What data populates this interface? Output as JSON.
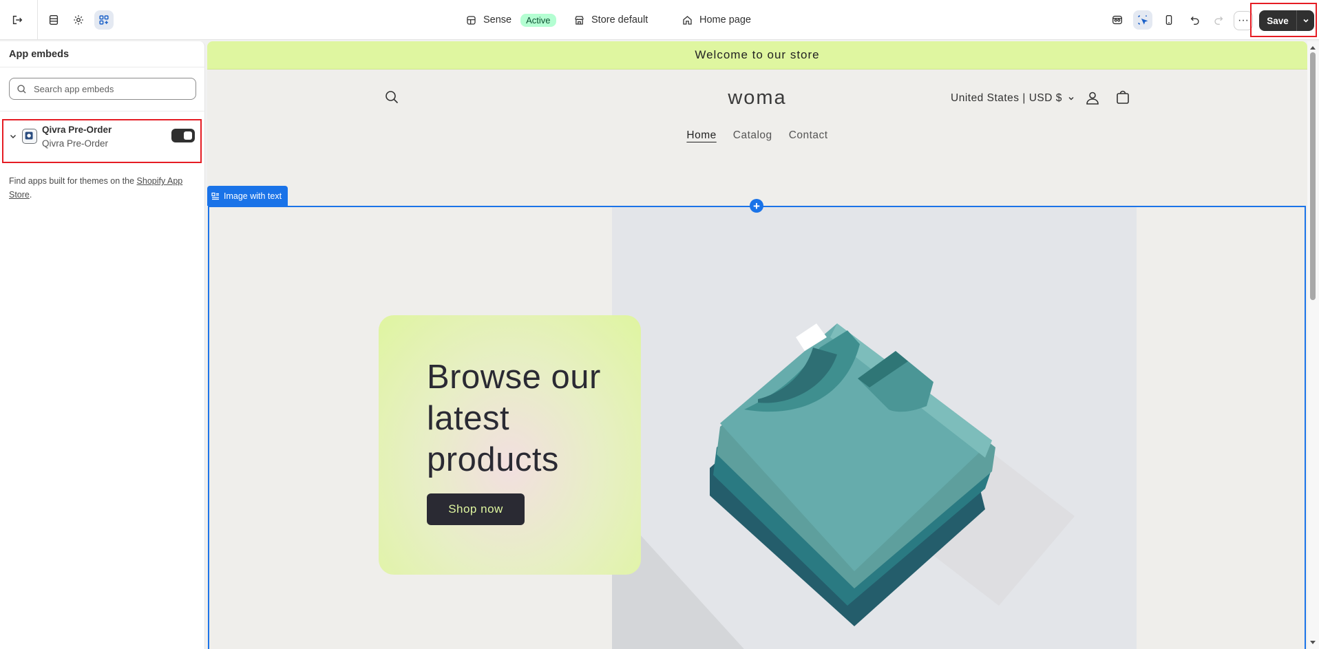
{
  "topbar": {
    "theme_name": "Sense",
    "theme_status": "Active",
    "store": "Store default",
    "page": "Home page",
    "save_label": "Save",
    "more_label": "···"
  },
  "sidebar": {
    "title": "App embeds",
    "search_placeholder": "Search app embeds",
    "embed": {
      "name": "Qivra Pre-Order",
      "subtitle": "Qivra Pre-Order",
      "enabled": true
    },
    "footer_text": "Find apps built for themes on the ",
    "footer_link": "Shopify App Store",
    "footer_end": "."
  },
  "preview": {
    "announcement": "Welcome to our store",
    "logo": "woma",
    "country": "United States | USD $",
    "nav": [
      "Home",
      "Catalog",
      "Contact"
    ],
    "section_tag": "Image with text",
    "headline": "Browse our latest products",
    "button": "Shop now"
  },
  "colors": {
    "accent": "#1a73e8",
    "highlight": "#e51c23",
    "announcement_bg": "#dff6a0",
    "dark": "#303030"
  }
}
